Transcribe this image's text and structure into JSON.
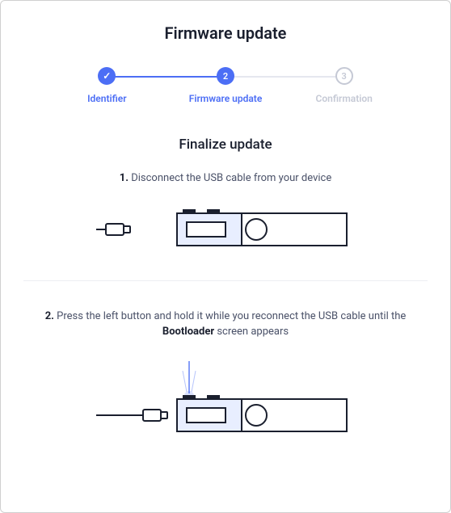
{
  "title": "Firmware update",
  "stepper": {
    "steps": [
      {
        "label": "Identifier",
        "state": "completed",
        "mark": "✓"
      },
      {
        "label": "Firmware update",
        "state": "active",
        "mark": "2"
      },
      {
        "label": "Confirmation",
        "state": "pending",
        "mark": "3"
      }
    ]
  },
  "subtitle": "Finalize update",
  "instructions": {
    "one_num": "1.",
    "one_text": " Disconnect the USB cable from your device",
    "two_num": "2.",
    "two_prefix": " Press the left button and hold it while you reconnect the USB cable until the ",
    "two_bold": "Bootloader",
    "two_suffix": " screen appears"
  },
  "colors": {
    "accent": "#4c6ef5",
    "muted": "#c5c9d5",
    "device_fill": "#e8eeff",
    "device_stroke": "#1a1f2e"
  }
}
